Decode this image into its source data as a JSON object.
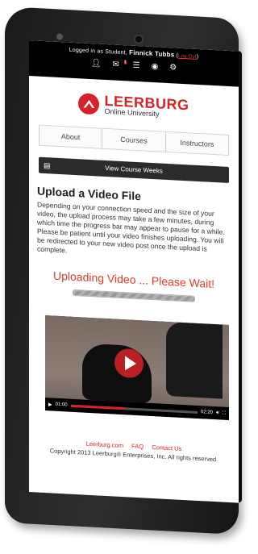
{
  "status_bar": {
    "logged_in_prefix": "Logged in as Student,",
    "user_name": "Finnick Tubbs",
    "logout_label": "Log Out",
    "notification_count": "1",
    "icons": [
      "user-icon",
      "mail-icon",
      "list-icon",
      "eye-icon",
      "gear-icon"
    ]
  },
  "logo": {
    "title": "LEERBURG",
    "subtitle": "Online University",
    "brand_color": "#d8222a"
  },
  "nav": {
    "items": [
      "About",
      "Courses",
      "Instructors"
    ]
  },
  "weeks_bar": {
    "label": "View Course Weeks"
  },
  "main": {
    "title": "Upload a Video File",
    "description": "Depending on your connection speed and the size of your video, the upload process may take a few minutes, during which time the progress bar may appear to pause for a while. Please be patient until your video finishes uploading. You will be redirected to your new video post once the upload is complete.",
    "uploading_text": "Uploading Video ... Please Wait!",
    "progress_fraction": 1.0
  },
  "video": {
    "current_time": "01:00",
    "duration": "02:20",
    "played_fraction": 0.43
  },
  "footer": {
    "links": [
      "Leerburg.com",
      "FAQ",
      "Contact Us"
    ],
    "copyright": "Copyright 2013 Leerburg® Enterprises, Inc. All rights reserved."
  }
}
